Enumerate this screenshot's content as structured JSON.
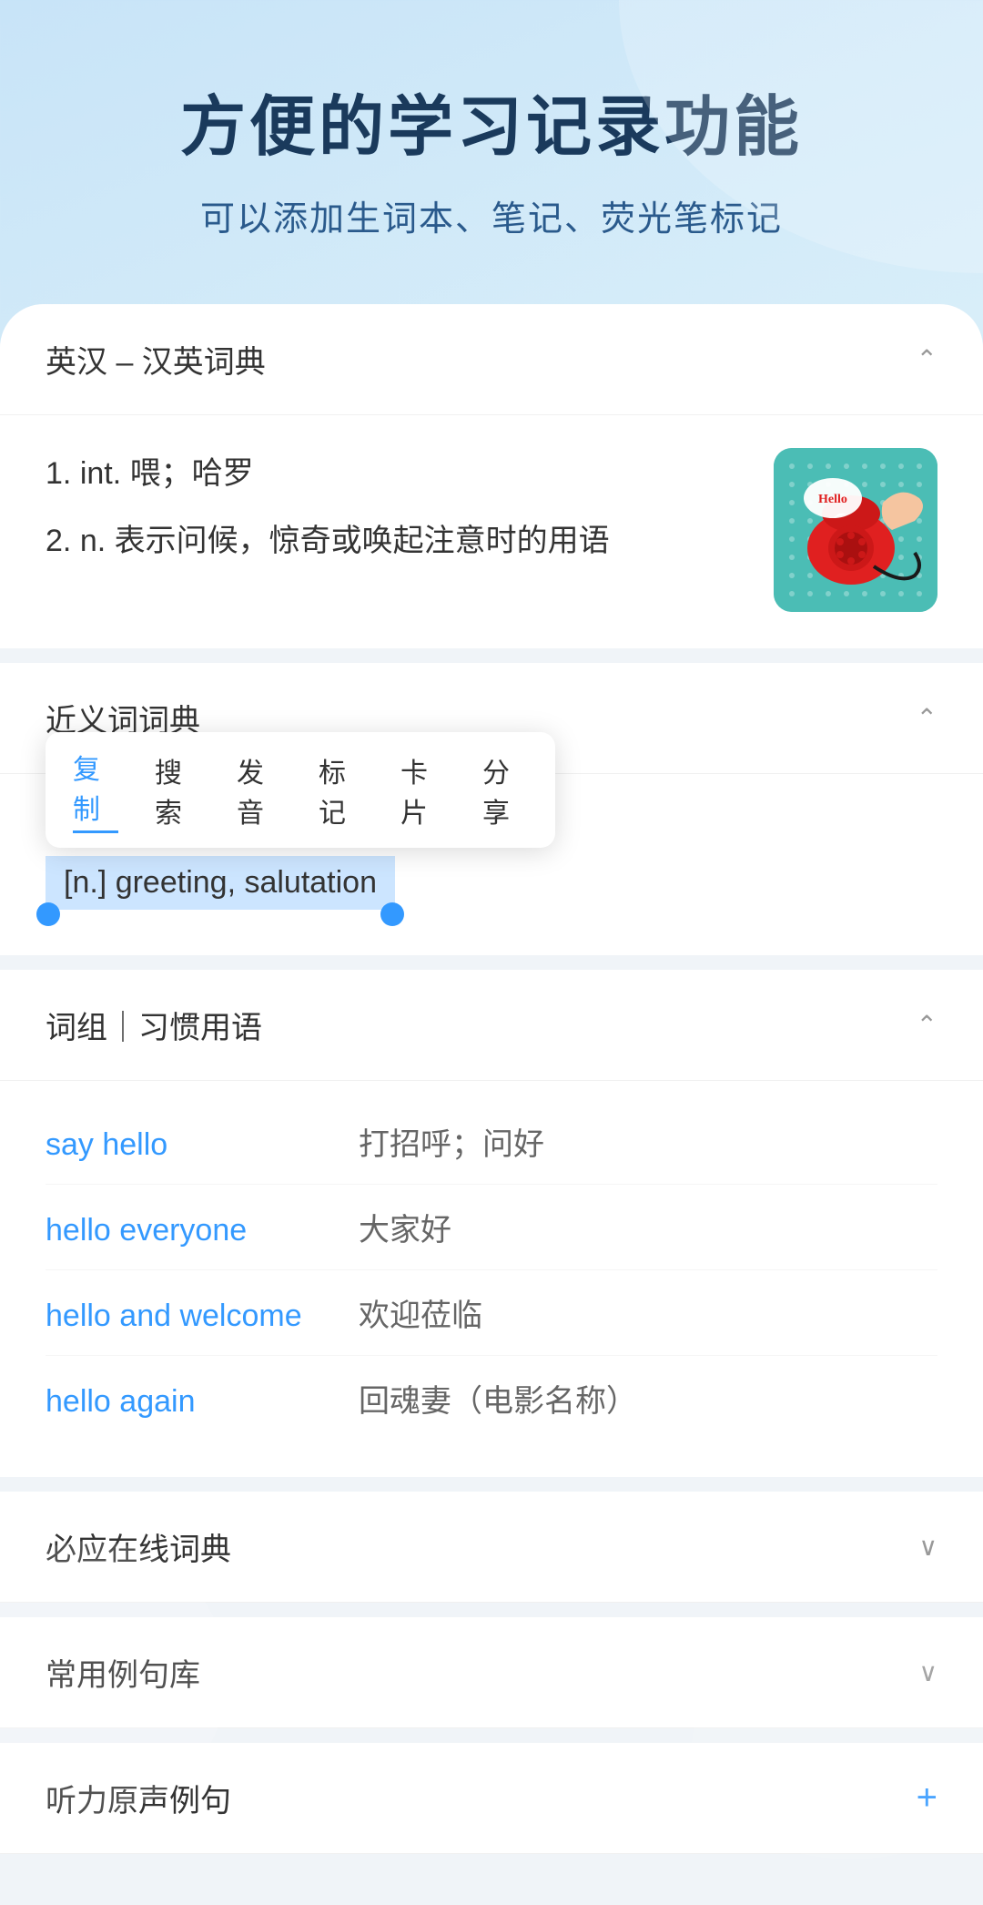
{
  "header": {
    "title": "方便的学习记录功能",
    "subtitle": "可以添加生词本、笔记、荧光笔标记"
  },
  "sections": {
    "english_chinese": {
      "title": "英汉 – 汉英词典",
      "definitions": [
        {
          "num": "1.",
          "text": "int. 喂；哈罗"
        },
        {
          "num": "2.",
          "text": "n. 表示问候，惊奇或唤起注意时的用语"
        }
      ]
    },
    "synonyms": {
      "title": "近义词词典",
      "context_menu": [
        "复制",
        "搜索",
        "发音",
        "标记",
        "卡片",
        "分享"
      ],
      "highlighted": "[n.] greeting, salutation"
    },
    "phrases": {
      "title": "词组｜习惯用语",
      "items": [
        {
          "en": "say hello",
          "zh": "打招呼；问好"
        },
        {
          "en": "hello everyone",
          "zh": "大家好"
        },
        {
          "en": "hello and welcome",
          "zh": "欢迎莅临"
        },
        {
          "en": "hello again",
          "zh": "回魂妻（电影名称）"
        }
      ]
    },
    "biyingzaixian": {
      "title": "必应在线词典"
    },
    "changyongliju": {
      "title": "常用例句库"
    },
    "tingliyuansheng": {
      "title": "听力原声例句"
    }
  },
  "icons": {
    "chevron_up": "∧",
    "chevron_down": "∨",
    "plus": "+"
  }
}
